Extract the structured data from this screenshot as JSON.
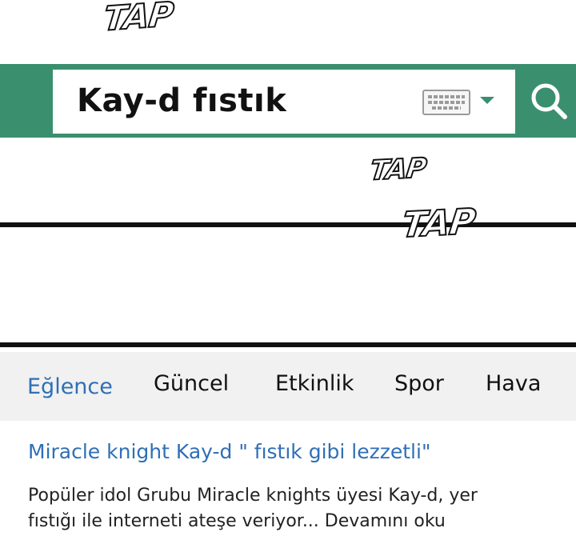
{
  "sfx": {
    "tap_top": "TAP",
    "tap_middle": "TAP",
    "tap_right": "TAP"
  },
  "search": {
    "query": "Kay-d fıstık",
    "keyboard_icon": "keyboard-icon",
    "dropdown_icon": "chevron-down-icon",
    "button_icon": "search-icon",
    "accent_color": "#3a8f6e"
  },
  "tabs": [
    {
      "label": "Eğlence",
      "active": true
    },
    {
      "label": "Güncel",
      "active": false
    },
    {
      "label": "Etkinlik",
      "active": false
    },
    {
      "label": "Spor",
      "active": false
    },
    {
      "label": "Hava",
      "active": false
    }
  ],
  "article": {
    "title": "Miracle knight Kay-d \" fıstık gibi lezzetli\"",
    "body_line_1": "Popüler idol Grubu Miracle knights üyesi Kay-d, yer",
    "body_line_2": "fıstığı ile interneti ateşe veriyor... Devamını oku",
    "link_color": "#2f6fb6"
  }
}
